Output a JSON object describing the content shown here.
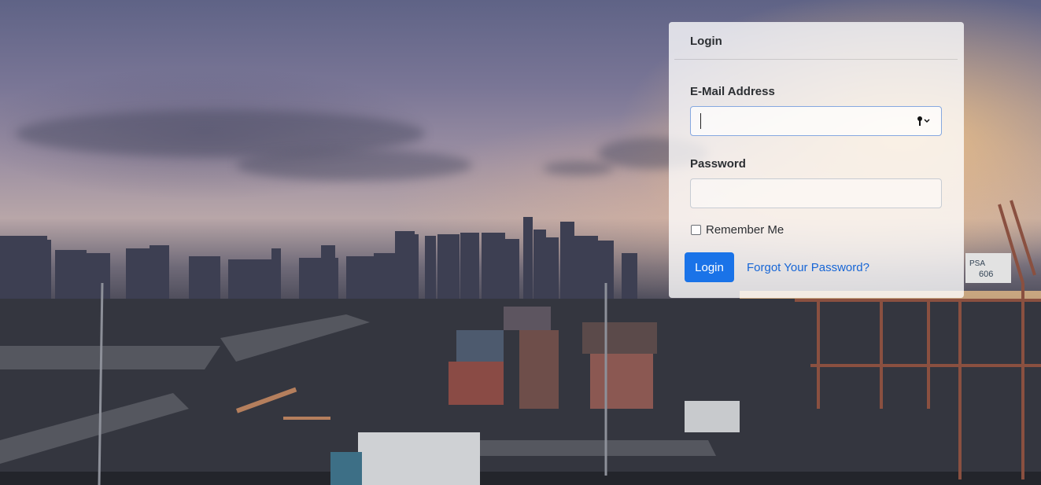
{
  "login_card": {
    "title": "Login",
    "email": {
      "label": "E-Mail Address",
      "value": "",
      "placeholder": ""
    },
    "password": {
      "label": "Password",
      "value": "",
      "placeholder": ""
    },
    "remember_me": {
      "label": "Remember Me",
      "checked": false
    },
    "submit_label": "Login",
    "forgot_link": "Forgot Your Password?"
  },
  "background": {
    "icon": "port-city-dusk-photo"
  },
  "colors": {
    "primary_button": "#1a73e8",
    "link": "#1766d6",
    "card_background": "#ffffffc7"
  }
}
